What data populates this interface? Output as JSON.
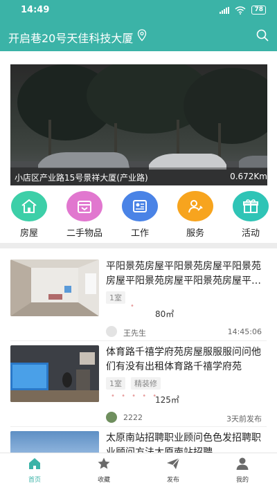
{
  "status_bar": {
    "time": "14:49",
    "battery": "78"
  },
  "header": {
    "location": "开启巷20号天佳科技大厦"
  },
  "banner": {
    "address": "小店区产业路15号景祥大厦(产业路)",
    "distance": "0.672Km"
  },
  "categories": [
    {
      "label": "房屋",
      "icon": "house-icon",
      "color": "#3dcfa8"
    },
    {
      "label": "二手物品",
      "icon": "box-icon",
      "color": "#e177cf"
    },
    {
      "label": "工作",
      "icon": "id-card-icon",
      "color": "#4a83e6"
    },
    {
      "label": "服务",
      "icon": "wrench-person-icon",
      "color": "#f7a41e"
    },
    {
      "label": "活动",
      "icon": "gift-icon",
      "color": "#2fc4b6"
    }
  ],
  "listings": [
    {
      "title": "平阳景苑房屋平阳景苑房屋平阳景苑房屋平阳景苑房屋平阳景苑房屋平阳景苑房屋",
      "tags": [
        "1室"
      ],
      "area": "80㎡",
      "owner": "王先生",
      "time": "14:45:06"
    },
    {
      "title": "体育路千禧学府苑房屋服服服问问他们有没有出租体育路千禧学府苑",
      "tags": [
        "1室",
        "精装修"
      ],
      "area": "125㎡",
      "owner": "2222",
      "time": "3天前发布"
    },
    {
      "title": "太原南站招聘职业顾问色色发招聘职业顾问方法太原南站招聘",
      "tags": [],
      "area": "",
      "owner": "",
      "time": ""
    }
  ],
  "tabbar": [
    {
      "label": "首页",
      "icon": "home-icon",
      "active": true
    },
    {
      "label": "收藏",
      "icon": "star-icon",
      "active": false
    },
    {
      "label": "发布",
      "icon": "paper-plane-icon",
      "active": false
    },
    {
      "label": "我的",
      "icon": "user-icon",
      "active": false
    }
  ],
  "colors": {
    "primary": "#3bb3a7",
    "divider": "#ececec"
  }
}
